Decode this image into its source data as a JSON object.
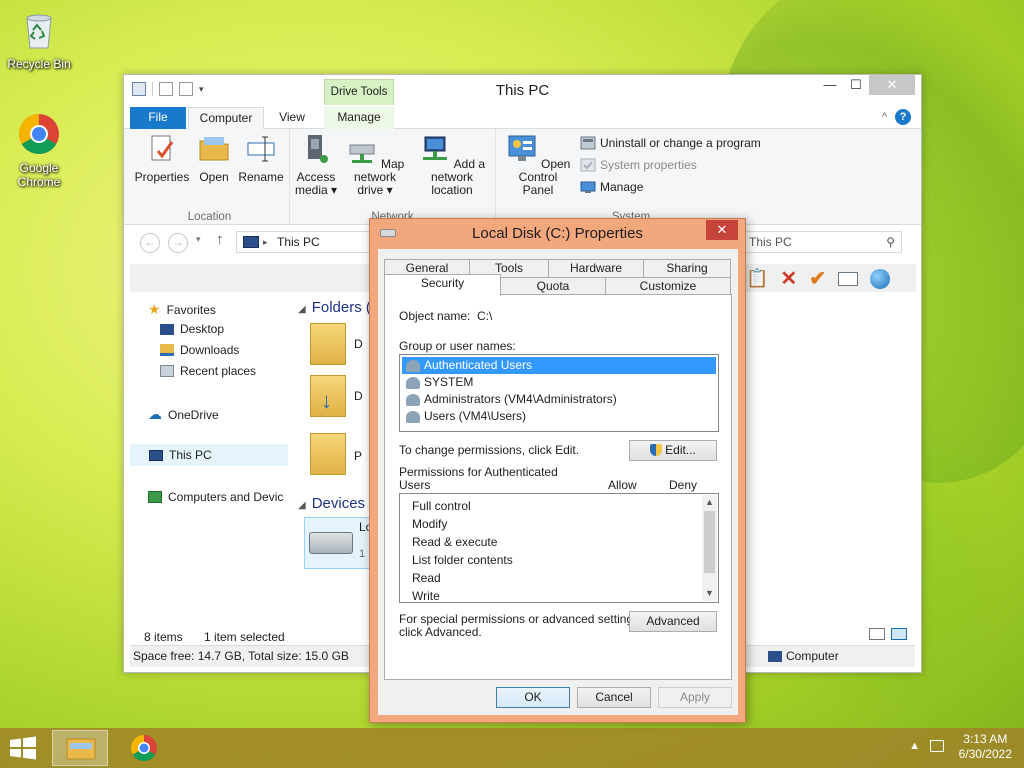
{
  "desktop": {
    "icons": [
      {
        "label": "Recycle Bin"
      },
      {
        "label": "Google Chrome"
      }
    ]
  },
  "explorer": {
    "title": "This PC",
    "context_tab": "Drive Tools",
    "tabs": [
      "File",
      "Computer",
      "View",
      "Manage"
    ],
    "ribbon": {
      "location": {
        "label": "Location",
        "buttons": [
          "Properties",
          "Open",
          "Rename"
        ]
      },
      "network": {
        "label": "Network",
        "buttons": [
          "Access media",
          "Map network drive",
          "Add a network location"
        ]
      },
      "system": {
        "label": "System",
        "open_cp": "Open Control Panel",
        "items": [
          "Uninstall or change a program",
          "System properties",
          "Manage"
        ]
      }
    },
    "address": "This PC",
    "search_placeholder": "This PC",
    "nav": {
      "favorites": "Favorites",
      "desktop": "Desktop",
      "downloads": "Downloads",
      "recent": "Recent places",
      "onedrive": "OneDrive",
      "thispc": "This PC",
      "network": "Computers and Devic"
    },
    "content": {
      "folders_header": "Folders (",
      "devices_header": "Devices a",
      "folder_letters": [
        "D",
        "D",
        "P"
      ],
      "device_name": "Lo",
      "device_sub": "1"
    },
    "status": {
      "items": "8 items",
      "selected": "1 item selected"
    },
    "details": {
      "space": "Space free: 14.7 GB, Total size: 15.0 GB",
      "computer": "Computer"
    }
  },
  "dialog": {
    "title": "Local Disk (C:) Properties",
    "tabs_row1": [
      "General",
      "Tools",
      "Hardware",
      "Sharing"
    ],
    "tabs_row2": [
      "Security",
      "Quota",
      "Customize"
    ],
    "object_name_label": "Object name:",
    "object_name_value": "C:\\",
    "group_label": "Group or user names:",
    "groups": [
      "Authenticated Users",
      "SYSTEM",
      "Administrators (VM4\\Administrators)",
      "Users (VM4\\Users)"
    ],
    "change_text": "To change permissions, click Edit.",
    "edit_button": "Edit...",
    "perm_label_line1": "Permissions for Authenticated",
    "perm_label_line2": "Users",
    "allow": "Allow",
    "deny": "Deny",
    "permissions": [
      "Full control",
      "Modify",
      "Read & execute",
      "List folder contents",
      "Read",
      "Write"
    ],
    "special_line1": "For special permissions or advanced settings,",
    "special_line2": "click Advanced.",
    "advanced_button": "Advanced",
    "ok": "OK",
    "cancel": "Cancel",
    "apply": "Apply"
  },
  "taskbar": {
    "time": "3:13 AM",
    "date": "6/30/2022"
  }
}
